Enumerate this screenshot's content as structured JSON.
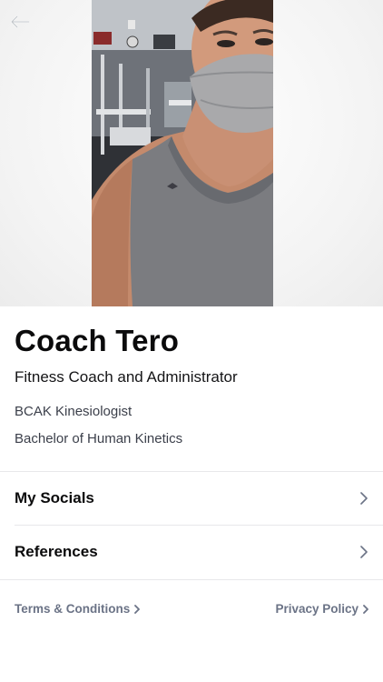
{
  "header": {
    "back_icon": "arrow-left-icon",
    "photo_description": "coach-selfie-photo"
  },
  "profile": {
    "name": "Coach Tero",
    "role": "Fitness Coach and Administrator",
    "credentials": [
      "BCAK Kinesiologist",
      "Bachelor of Human Kinetics"
    ]
  },
  "menu": {
    "items": [
      {
        "label": "My Socials",
        "icon": "chevron-right-icon"
      },
      {
        "label": "References",
        "icon": "chevron-right-icon"
      }
    ]
  },
  "footer": {
    "terms_label": "Terms & Conditions",
    "privacy_label": "Privacy Policy",
    "link_color": "#6b7386"
  },
  "colors": {
    "text": "#0b0b0c",
    "secondary_text": "#3b3f4a",
    "divider": "#e8e8ea",
    "background": "#ffffff"
  }
}
